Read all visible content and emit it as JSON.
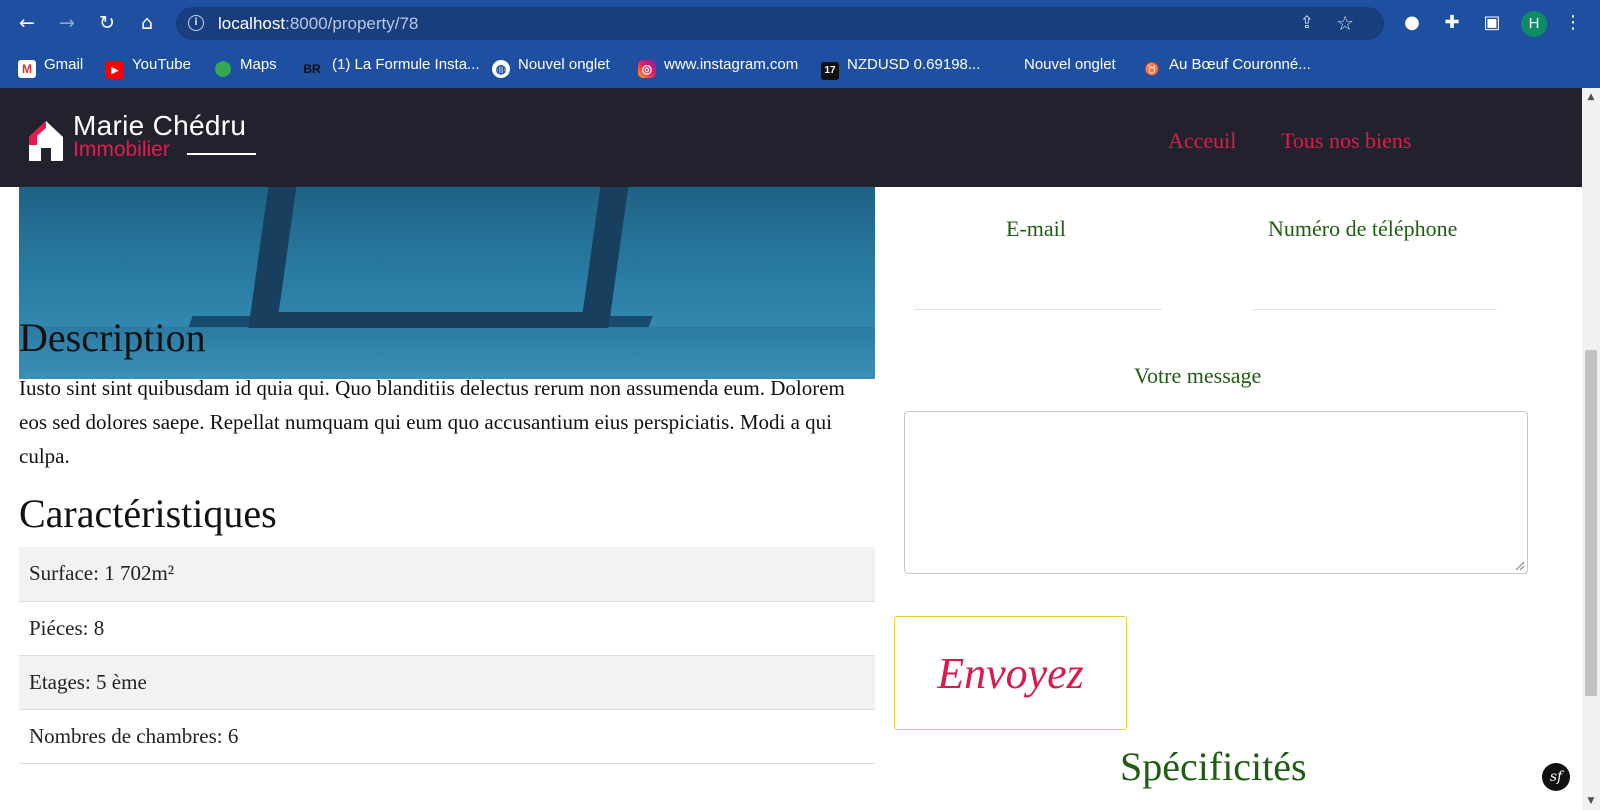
{
  "browser": {
    "url_host": "localhost",
    "url_path": ":8000/property/78",
    "profile_initial": "H",
    "bookmarks": [
      {
        "label": "Gmail",
        "icon": "gmail-icon"
      },
      {
        "label": "YouTube",
        "icon": "youtube-icon"
      },
      {
        "label": "Maps",
        "icon": "maps-icon"
      },
      {
        "label": "(1) La Formule Insta...",
        "icon": "br-icon",
        "icon_text": "BR"
      },
      {
        "label": "Nouvel onglet",
        "icon": "globe-icon"
      },
      {
        "label": "www.instagram.com",
        "icon": "instagram-icon"
      },
      {
        "label": "NZDUSD 0.69198...",
        "icon": "tradingview-icon"
      },
      {
        "label": "Nouvel onglet",
        "icon": "ghost-icon"
      },
      {
        "label": "Au Bœuf Couronné...",
        "icon": "bull-icon"
      }
    ]
  },
  "header": {
    "logo_name": "Marie Chédru",
    "logo_sub": "Immobilier",
    "nav": [
      "Acceuil",
      "Tous nos biens"
    ]
  },
  "property": {
    "description_title": "Description",
    "description": "Iusto sint sint quibusdam id quia qui. Quo blanditiis delectus rerum non assumenda eum. Dolorem eos sed dolores saepe. Repellat numquam qui eum quo accusantium eius perspiciatis. Modi a qui culpa.",
    "characteristics_title": "Caractéristiques",
    "characteristics": [
      "Surface: 1 702m²",
      "Piéces: 8",
      "Etages: 5 ème",
      "Nombres de chambres: 6"
    ]
  },
  "form": {
    "email_label": "E-mail",
    "phone_label": "Numéro de téléphone",
    "message_label": "Votre message",
    "message_value": "",
    "submit_label": "Envoyez"
  },
  "specs_title": "Spécificités",
  "colors": {
    "header_bg": "#22222f",
    "accent": "#e01b45",
    "label_green": "#1f5d12",
    "chrome_blue": "#1e4fa0"
  }
}
